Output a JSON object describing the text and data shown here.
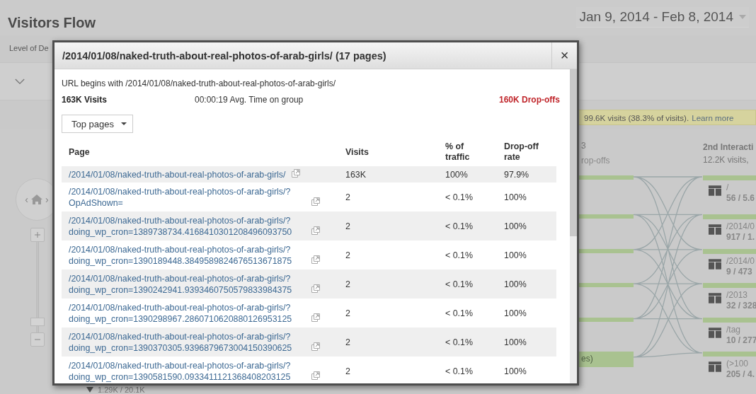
{
  "page": {
    "title": "Visitors Flow",
    "date_range": "Jan 9, 2014 - Feb 8, 2014",
    "level_label": "Level of De",
    "notice": {
      "text": "99.6K visits (38.3% of visits).",
      "link": "Learn more"
    }
  },
  "flow": {
    "column_heading": "3",
    "column_subheading": "rop-offs",
    "partial_label": "es)",
    "bottom_stats": "1.29K / 20.1K",
    "pan": {
      "left": "‹",
      "right": "›"
    },
    "zoom": {
      "level": 0.08
    },
    "second_interaction": {
      "title": "2nd Interacti",
      "visits": "12.2K visits,"
    },
    "nodes": [
      {
        "label": "/",
        "stats": "56 / 5.6"
      },
      {
        "label": "/2014/0",
        "stats": "917 / 1."
      },
      {
        "label": "/2014/0",
        "stats": "9 / 473"
      },
      {
        "label": "/2013",
        "stats": "32 / 328"
      },
      {
        "label": "/tag",
        "stats": "10 / 277"
      },
      {
        "label": "(>100",
        "stats": "205 / 4."
      }
    ]
  },
  "dialog": {
    "title": "/2014/01/08/naked-truth-about-real-photos-of-arab-girls/ (17 pages)",
    "close": "×",
    "subtitle": "URL begins with /2014/01/08/naked-truth-about-real-photos-of-arab-girls/",
    "visits": "163K Visits",
    "avg_time": "00:00:19 Avg. Time on group",
    "dropoffs": "160K Drop-offs",
    "dropdown": "Top pages",
    "columns": [
      "Page",
      "Visits",
      "% of traffic",
      "Drop-off rate"
    ],
    "rows": [
      {
        "page": "/2014/01/08/naked-truth-about-real-photos-of-arab-girls/",
        "visits": "163K",
        "traffic": "100%",
        "dropoff": "97.9%"
      },
      {
        "page": "/2014/01/08/naked-truth-about-real-photos-of-arab-girls/?OpAdShown=",
        "visits": "2",
        "traffic": "< 0.1%",
        "dropoff": "100%"
      },
      {
        "page": "/2014/01/08/naked-truth-about-real-photos-of-arab-girls/?doing_wp_cron=1389738734.4168410301208496093750",
        "visits": "2",
        "traffic": "< 0.1%",
        "dropoff": "100%"
      },
      {
        "page": "/2014/01/08/naked-truth-about-real-photos-of-arab-girls/?doing_wp_cron=1390189448.3849589824676513671875",
        "visits": "2",
        "traffic": "< 0.1%",
        "dropoff": "100%"
      },
      {
        "page": "/2014/01/08/naked-truth-about-real-photos-of-arab-girls/?doing_wp_cron=1390242941.9393460750579833984375",
        "visits": "2",
        "traffic": "< 0.1%",
        "dropoff": "100%"
      },
      {
        "page": "/2014/01/08/naked-truth-about-real-photos-of-arab-girls/?doing_wp_cron=1390298967.2860710620880126953125",
        "visits": "2",
        "traffic": "< 0.1%",
        "dropoff": "100%"
      },
      {
        "page": "/2014/01/08/naked-truth-about-real-photos-of-arab-girls/?doing_wp_cron=1390370305.9396879673004150390625",
        "visits": "2",
        "traffic": "< 0.1%",
        "dropoff": "100%"
      },
      {
        "page": "/2014/01/08/naked-truth-about-real-photos-of-arab-girls/?doing_wp_cron=1390581590.0933411121368408203125",
        "visits": "2",
        "traffic": "< 0.1%",
        "dropoff": "100%"
      }
    ]
  }
}
